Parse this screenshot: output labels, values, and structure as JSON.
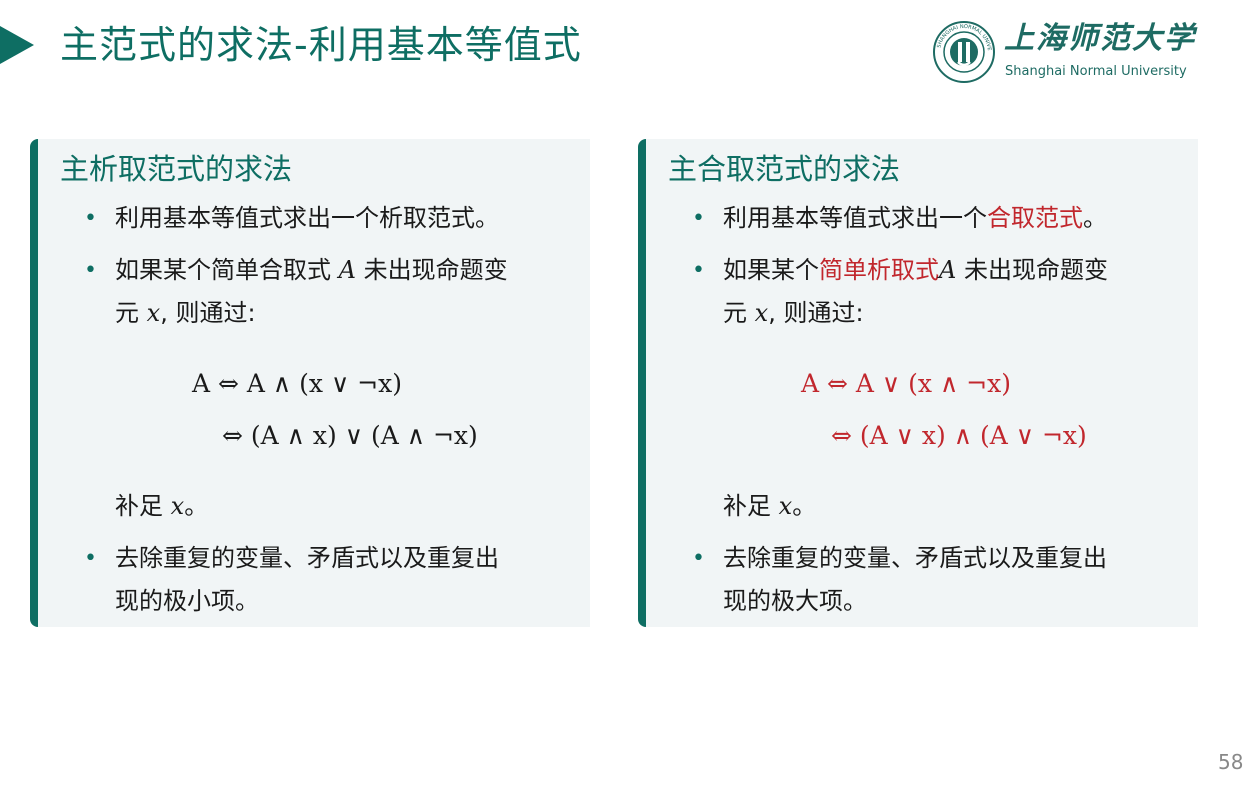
{
  "header": {
    "title": "主范式的求法-利用基本等值式"
  },
  "logo": {
    "cn": "上海师范大学",
    "en": "Shanghai Normal University",
    "seal_text": "SHANGHAI NORMAL UNIVERSITY"
  },
  "left_block": {
    "title": "主析取范式的求法",
    "b1": "利用基本等值式求出一个析取范式。",
    "b2_a": "如果某个简单合取式 ",
    "b2_var": "A",
    "b2_b": " 未出现命题变",
    "b2_c": "元 ",
    "b2_var2": "x",
    "b2_d": ", 则通过:",
    "f1": "A ⇔ A ∧ (x ∨ ¬x)",
    "f2": "⇔ (A ∧ x) ∨ (A ∧ ¬x)",
    "complete_a": "补足 ",
    "complete_var": "x",
    "complete_b": "。",
    "b3_a": "去除重复的变量、矛盾式以及重复出",
    "b3_b": "现的极小项。"
  },
  "right_block": {
    "title": "主合取范式的求法",
    "b1_a": "利用基本等值式求出一个",
    "b1_red": "合取范式",
    "b1_b": "。",
    "b2_a": "如果某个",
    "b2_red": "简单析取式",
    "b2_var": "A",
    "b2_b": " 未出现命题变",
    "b2_c": "元 ",
    "b2_var2": "x",
    "b2_d": ", 则通过:",
    "f1": "A ⇔ A ∨ (x ∧ ¬x)",
    "f2": "⇔ (A ∨ x) ∧ (A ∨ ¬x)",
    "complete_a": "补足 ",
    "complete_var": "x",
    "complete_b": "。",
    "b3_a": "去除重复的变量、矛盾式以及重复出",
    "b3_b": "现的极大项。"
  },
  "footer": {
    "page_number": "58"
  },
  "colors": {
    "accent": "#0e6e63",
    "highlight": "#c1272d",
    "block_bg": "#f1f5f6"
  },
  "icons": {
    "title_marker": "triangle-arrow-icon",
    "logo_seal": "university-seal-icon"
  }
}
